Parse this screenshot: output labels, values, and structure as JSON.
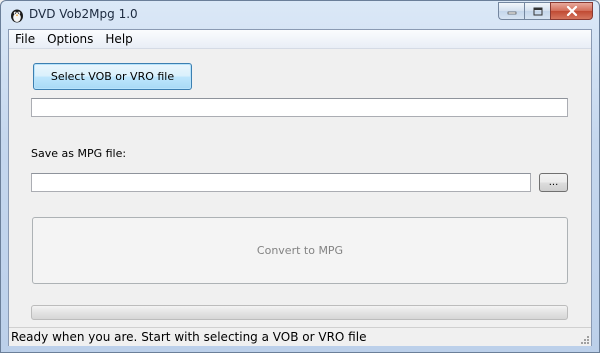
{
  "window": {
    "title": "DVD Vob2Mpg 1.0",
    "icon": "penguin-app-icon"
  },
  "caption_buttons": {
    "minimize_icon": "minimize-icon",
    "maximize_icon": "maximize-icon",
    "close_icon": "close-icon"
  },
  "menu": {
    "items": [
      {
        "label": "File"
      },
      {
        "label": "Options"
      },
      {
        "label": "Help"
      }
    ]
  },
  "source": {
    "select_button_label": "Select VOB or VRO file",
    "path_value": ""
  },
  "destination": {
    "label": "Save as MPG file:",
    "path_value": "",
    "browse_button_label": "..."
  },
  "convert": {
    "button_label": "Convert to MPG",
    "enabled": false
  },
  "progress": {
    "fraction": 0
  },
  "status": {
    "text": "Ready when you are. Start with selecting a VOB or VRO file"
  },
  "colors": {
    "accent_button_border": "#3c7fb1",
    "close_button": "#c04a33",
    "disabled_text": "#838383"
  }
}
